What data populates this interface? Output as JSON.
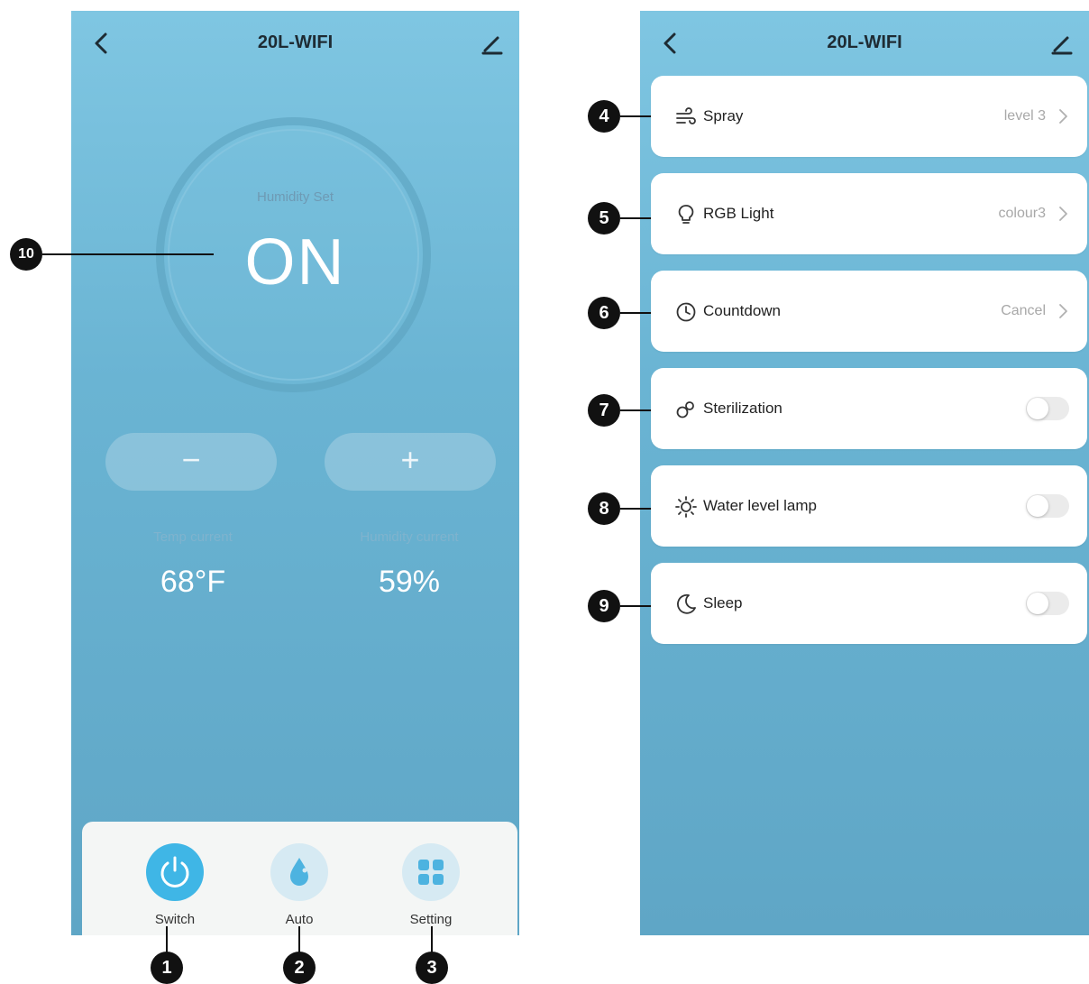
{
  "app": {
    "title": "20L-WIFI"
  },
  "left": {
    "humidity_label": "Humidity Set",
    "humidity_value": "ON",
    "minus": "−",
    "plus": "+",
    "temp_label": "Temp current",
    "temp_value": "68°F",
    "hum_current_label": "Humidity current",
    "hum_current_value": "59%",
    "tabs": [
      {
        "label": "Switch",
        "icon": "power-icon"
      },
      {
        "label": "Auto",
        "icon": "water-drop-icon"
      },
      {
        "label": "Setting",
        "icon": "grid-icon"
      }
    ]
  },
  "right": {
    "items": [
      {
        "label": "Spray",
        "value": "level 3",
        "icon": "wind-icon",
        "type": "nav"
      },
      {
        "label": "RGB Light",
        "value": "colour3",
        "icon": "bulb-icon",
        "type": "nav"
      },
      {
        "label": "Countdown",
        "value": "Cancel",
        "icon": "clock-icon",
        "type": "nav"
      },
      {
        "label": "Sterilization",
        "icon": "sterilize-icon",
        "type": "toggle",
        "on": false
      },
      {
        "label": "Water level lamp",
        "icon": "sun-icon",
        "type": "toggle",
        "on": false
      },
      {
        "label": "Sleep",
        "icon": "moon-icon",
        "type": "toggle",
        "on": false
      }
    ]
  },
  "callouts": [
    "1",
    "2",
    "3",
    "4",
    "5",
    "6",
    "7",
    "8",
    "9",
    "10"
  ],
  "colors": {
    "accent": "#3fb6e6",
    "background": "#6ab4d3"
  }
}
